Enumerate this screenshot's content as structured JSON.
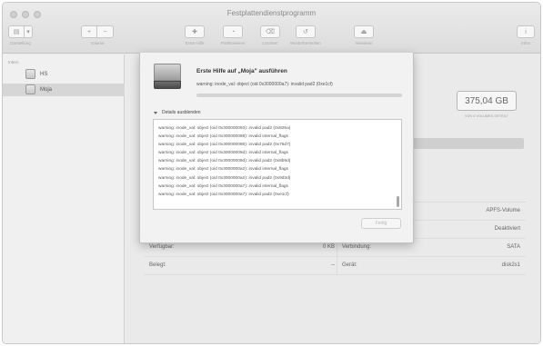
{
  "window": {
    "title": "Festplattendienstprogramm"
  },
  "toolbar": {
    "darstellung": "Darstellung",
    "volume": "Volume",
    "erste_hilfe": "Erste Hilfe",
    "partitionieren": "Partitionieren",
    "loeschen": "Löschen",
    "wiederherstellen": "Wiederherstellen",
    "aktivieren": "Aktivieren",
    "info": "Infos"
  },
  "sidebar": {
    "header": "Intern",
    "items": [
      {
        "label": "HS"
      },
      {
        "label": "Moja"
      }
    ]
  },
  "main": {
    "capacity": "375,04 GB",
    "capacity_sub": "VON 4 VOLUMES GETEILT",
    "info_rows": [
      {
        "l1": "",
        "v1": "",
        "l2": "",
        "v2": "APFS-Volume"
      },
      {
        "l1": "",
        "v1": "",
        "l2": "",
        "v2": "Deaktiviert"
      },
      {
        "l1": "Verfügbar:",
        "v1": "0 KB",
        "l2": "Verbindung:",
        "v2": "SATA"
      },
      {
        "l1": "Belegt:",
        "v1": "--",
        "l2": "Gerät:",
        "v2": "disk2s1"
      }
    ]
  },
  "sheet": {
    "title": "Erste Hilfe auf „Moja\" ausführen",
    "status": "warning: inode_val: object (oid 0x3000000a7): invalid pad2 (0xe1cf)",
    "details_label": "Details ausblenden",
    "log": [
      "warning: inode_val: object (oid 0x300000093): invalid pad2 (0x826a)",
      "warning: inode_val: object (oid 0x300000098): invalid internal_flags",
      "warning: inode_val: object (oid 0x300000098): invalid pad2 (0x75d7)",
      "warning: inode_val: object (oid 0x30000009d): invalid internal_flags",
      "warning: inode_val: object (oid 0x30000009d): invalid pad2 (0x8b9d)",
      "warning: inode_val: object (oid 0x3000000a2): invalid internal_flags",
      "warning: inode_val: object (oid 0x3000000a2): invalid pad2 (0x9d3d)",
      "warning: inode_val: object (oid 0x3000000a7): invalid internal_flags",
      "warning: inode_val: object (oid 0x3000000a7): invalid pad2 (0xe1cf)"
    ],
    "done_label": "Fertig"
  }
}
